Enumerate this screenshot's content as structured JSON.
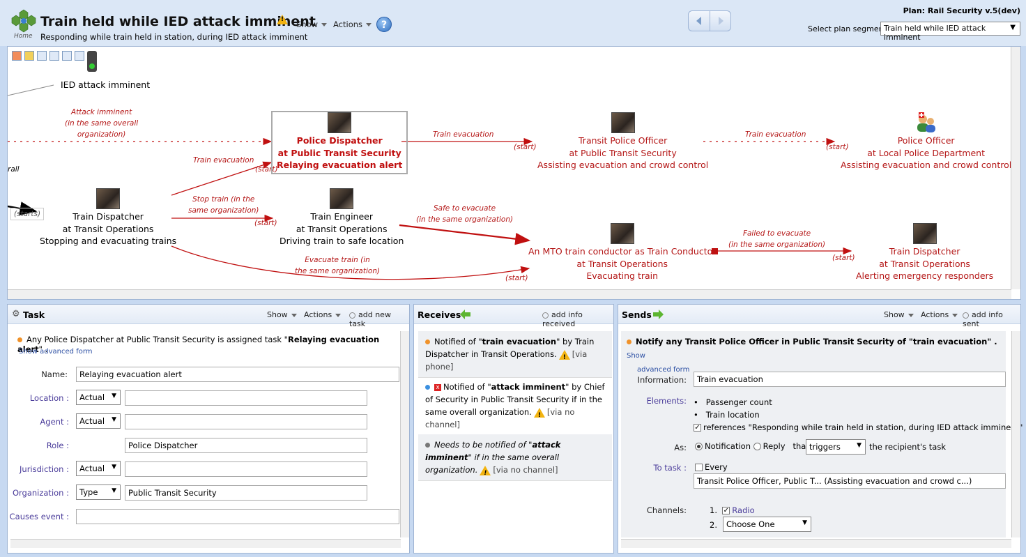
{
  "header": {
    "home_label": "Home",
    "title": "Train held while IED attack imminent",
    "subtitle": "Responding while train held in station, during IED attack imminent",
    "show_menu": "Show",
    "actions_menu": "Actions",
    "help": "?",
    "plan": "Plan: Rail Security v.5(dev)",
    "segment_label": "Select plan segment:",
    "segment_value": "Train held while IED attack imminent"
  },
  "diagram": {
    "event": "IED attack imminent",
    "nodes": [
      {
        "photo": true,
        "line1": "Train Dispatcher",
        "line2": "at Transit Operations",
        "line3": "Stopping and evacuating trains"
      },
      {
        "photo": true,
        "line1": "Police Dispatcher",
        "line2": "at Public Transit Security",
        "line3": "Relaying evacuation alert"
      },
      {
        "photo": true,
        "line1": "Train Engineer",
        "line2": "at Transit Operations",
        "line3": "Driving train to safe location"
      },
      {
        "photo": true,
        "line1": "Transit Police Officer",
        "line2": "at Public Transit Security",
        "line3": "Assisting evacuation and crowd control"
      },
      {
        "photo": true,
        "line1": "An MTO train conductor as Train Conductor",
        "line2": "at Transit Operations",
        "line3": "Evacuating train"
      },
      {
        "photo": false,
        "line1": "Police Officer",
        "line2": "at Local Police Department",
        "line3": "Assisting evacuation and crowd control"
      },
      {
        "photo": true,
        "line1": "Train Dispatcher",
        "line2": "at Transit Operations",
        "line3": "Alerting emergency responders"
      }
    ],
    "flows": {
      "attack": "Attack imminent\n(in the same overall\norganization)",
      "train_evac_1": "Train evacuation",
      "train_evac_2": "Train evacuation",
      "train_evac_3": "Train evacuation",
      "stop_train": "Stop train (in the\nsame organization)",
      "safe_evac": "Safe to evacuate\n(in the same organization)",
      "evac_train": "Evacuate train (in\nthe same organization)",
      "failed_evac": "Failed to evacuate\n(in the same organization)",
      "start": "(start)",
      "starts": "(starts)",
      "rall": "rall"
    }
  },
  "task": {
    "title": "Task",
    "show": "Show",
    "actions": "Actions",
    "add": "add new task",
    "assignment_prefix": "Any Police Dispatcher at Public Transit Security is assigned task \"",
    "assignment_task": "Relaying evacuation alert",
    "assignment_suffix": "\" .",
    "advanced": "Show advanced form",
    "name_label": "Name:",
    "name_value": "Relaying evacuation alert",
    "location_label": "Location :",
    "agent_label": "Agent :",
    "role_label": "Role :",
    "jurisdiction_label": "Jurisdiction :",
    "organization_label": "Organization :",
    "causes_label": "Causes event :",
    "actual": "Actual",
    "type": "Type",
    "role_value": "Police Dispatcher",
    "organization_value": "Public Transit Security"
  },
  "receives": {
    "title": "Receives",
    "add": "add info received",
    "items": [
      {
        "pre": "Notified of \"",
        "bold": "train evacuation",
        "post": "\" by Train Dispatcher in Transit Operations.",
        "via": "[via phone]"
      },
      {
        "pre": "Notified of \"",
        "bold": "attack imminent",
        "post": "\" by Chief of Security in Public Transit Security if in the same overall organization.",
        "via": "[via no channel]"
      },
      {
        "pre": "Needs to be notified of \"",
        "bold": "attack imminent",
        "post": "\" if in the same overall organization.",
        "via": "[via no channel]"
      }
    ]
  },
  "sends": {
    "title": "Sends",
    "show": "Show",
    "actions": "Actions",
    "add": "add info sent",
    "notify": "Notify any Transit Police Officer in Public Transit Security of \"train evacuation\" .",
    "show_link": "Show",
    "advanced": "advanced form",
    "information_label": "Information:",
    "information_value": "Train evacuation",
    "elements_label": "Elements:",
    "elements": [
      "Passenger count",
      "Train location"
    ],
    "references": "references \"Responding while train held in station, during IED attack imminent\"",
    "as_label": "As:",
    "notification": "Notification",
    "reply": "Reply",
    "that": "that",
    "triggers": "triggers",
    "recipient_task": "the recipient's task",
    "to_task_label": "To task :",
    "every": "Every",
    "task_value": "Transit Police Officer, Public T... (Assisting evacuation and crowd c...)",
    "channels_label": "Channels:",
    "ch1_num": "1.",
    "ch1": "Radio",
    "ch2_num": "2.",
    "ch2": "Choose One"
  }
}
